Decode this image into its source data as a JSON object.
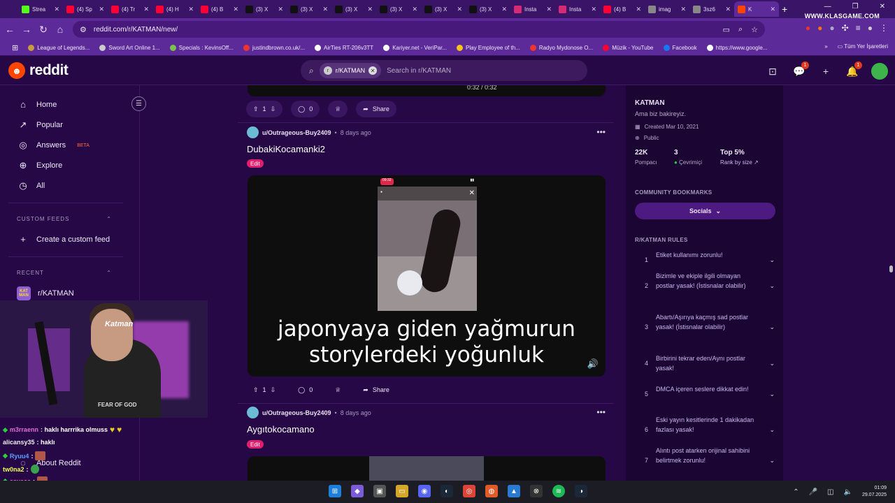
{
  "browser": {
    "tabs": [
      {
        "label": "Strea",
        "icon": "kick-icon",
        "color": "#53fc18"
      },
      {
        "label": "(4) Sp",
        "icon": "youtube-icon",
        "color": "#ff0033"
      },
      {
        "label": "(4) Tr",
        "icon": "youtube-icon",
        "color": "#ff0033"
      },
      {
        "label": "(4) H",
        "icon": "youtube-icon",
        "color": "#ff0033"
      },
      {
        "label": "(4) B",
        "icon": "youtube-icon",
        "color": "#ff0033"
      },
      {
        "label": "(3) X",
        "icon": "x-icon",
        "color": "#111111"
      },
      {
        "label": "(3) X",
        "icon": "x-icon",
        "color": "#111111"
      },
      {
        "label": "(3) X",
        "icon": "x-icon",
        "color": "#111111"
      },
      {
        "label": "(3) X",
        "icon": "x-icon",
        "color": "#111111"
      },
      {
        "label": "(3) X",
        "icon": "x-icon",
        "color": "#111111"
      },
      {
        "label": "(3) X",
        "icon": "x-icon",
        "color": "#111111"
      },
      {
        "label": "Insta",
        "icon": "instagram-icon",
        "color": "#d62976"
      },
      {
        "label": "Insta",
        "icon": "instagram-icon",
        "color": "#d62976"
      },
      {
        "label": "(4) B",
        "icon": "youtube-icon",
        "color": "#ff0033"
      },
      {
        "label": "imag",
        "icon": "google-icon",
        "color": "#888888"
      },
      {
        "label": "3sz6",
        "icon": "globe-icon",
        "color": "#888888"
      },
      {
        "label": "K",
        "icon": "reddit-icon",
        "color": "#ff4500",
        "active": true
      }
    ],
    "watermark": "WWW.KLASGAME.COM",
    "url": "reddit.com/r/KATMAN/new/",
    "bookmarks": [
      "League of Legends...",
      "Sword Art Online 1...",
      "Specials : KevinsOff...",
      "justindbrown.co.uk/...",
      "AirTies RT-206v3TT",
      "Kariyer.net - VeriPar...",
      "Play Employee of th...",
      "Radyo Mydonose O...",
      "Müzik - YouTube",
      "Facebook",
      "https://www.google..."
    ],
    "bookmarks_all": "Tüm Yer İşaretleri"
  },
  "header": {
    "logo_text": "reddit",
    "search_chip": "r/KATMAN",
    "search_placeholder": "Search in r/KATMAN",
    "chat_badge": "1",
    "notif_badge": "1"
  },
  "sidebar": {
    "nav": [
      {
        "label": "Home",
        "icon": "home-icon"
      },
      {
        "label": "Popular",
        "icon": "popular-icon"
      },
      {
        "label": "Answers",
        "icon": "answers-icon",
        "badge": "BETA"
      },
      {
        "label": "Explore",
        "icon": "explore-icon"
      },
      {
        "label": "All",
        "icon": "all-icon"
      }
    ],
    "custom_feeds_header": "CUSTOM FEEDS",
    "create_feed": "Create a custom feed",
    "recent_header": "RECENT",
    "recent_item": "r/KATMAN",
    "recent_avatar": "KAT MAN",
    "about": "About Reddit"
  },
  "feed": {
    "top_bar": {
      "votes": "1",
      "comments": "0",
      "share": "Share",
      "time": "0:32 / 0:32"
    },
    "posts": [
      {
        "user": "u/Outrageous-Buy2409",
        "date": "8 days ago",
        "title": "DubakiKocamanki2",
        "flair": "Edit",
        "caption_line1": "japonyaya giden yağmurun",
        "caption_line2": "storylerdeki yoğunluk",
        "story_time": "09:32",
        "votes": "1",
        "comments": "0",
        "share": "Share"
      },
      {
        "user": "u/Outrageous-Buy2409",
        "date": "8 days ago",
        "title": "Aygıtokocamano",
        "flair": "Edit"
      }
    ]
  },
  "community": {
    "name": "KATMAN",
    "description": "Ama biz bakireyiz.",
    "created": "Created Mar 10, 2021",
    "visibility": "Public",
    "members": "22K",
    "members_label": "Pompacı",
    "online": "3",
    "online_label": "Çevrimiçi",
    "rank": "Top 5%",
    "rank_label": "Rank by size",
    "bookmarks_header": "COMMUNITY BOOKMARKS",
    "socials": "Socials",
    "rules_header": "R/KATMAN RULES",
    "rules": [
      "Etiket kullanımı zorunlu!",
      "Bizimle ve ekiple ilgili olmayan postlar yasak! (İstisnalar olabilir)",
      "Abartı/Aşırıya kaçmış sad postlar yasak! (İstisnalar olabilir)",
      "Birbirini tekrar eden/Aynı postlar yasak!",
      "DMCA içeren seslere dikkat edin!",
      "Eski yayın kesitlerinde 1 dakikadan fazlası yasak!",
      "Alıntı post atarken orijinal sahibini belirtmek zorunlu!"
    ]
  },
  "stream": {
    "webcam_logo": "Katman",
    "shirt_text": "FEAR OF GOD",
    "chat": [
      {
        "user": "m3rraenn",
        "text": ": haklı harrrika olmuss"
      },
      {
        "user": "alicansy35",
        "text": ": haklı"
      },
      {
        "user": "Ryuu4",
        "text": ":"
      },
      {
        "user": "tw0na2",
        "text": ":"
      },
      {
        "user": "esyace",
        "text": ":"
      }
    ]
  },
  "taskbar": {
    "time": "01:09",
    "date": "29.07.2025"
  }
}
